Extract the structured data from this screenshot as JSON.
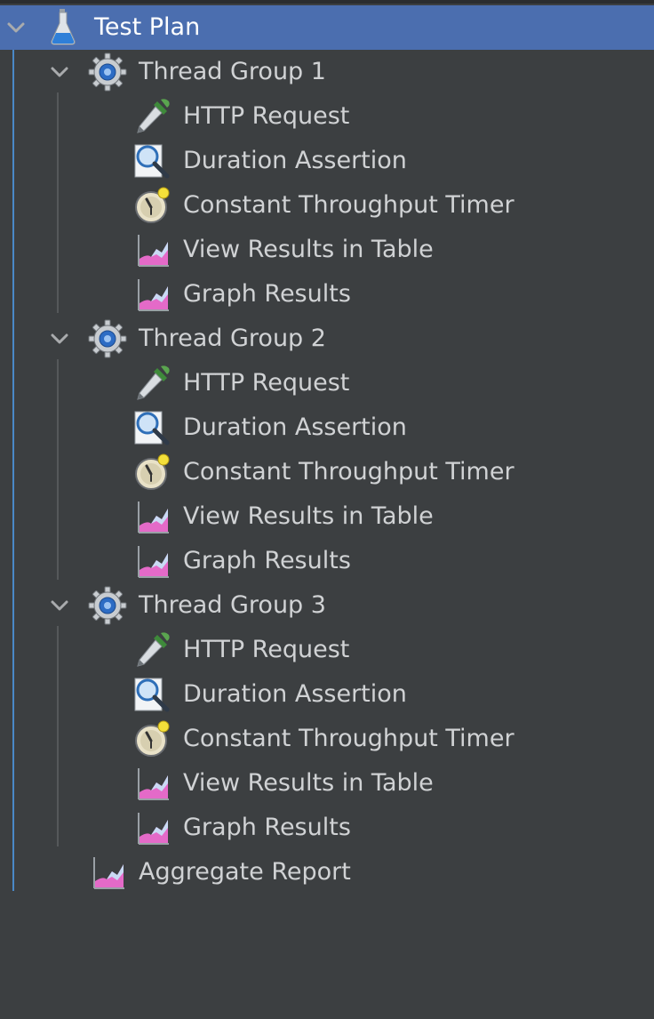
{
  "tree": {
    "root": {
      "label": "Test Plan",
      "icon": "test-plan-flask-icon",
      "expanded": true,
      "selected": true
    },
    "thread_groups": [
      {
        "label": "Thread Group 1",
        "icon": "gear-icon",
        "expanded": true,
        "children": [
          {
            "label": "HTTP Request",
            "icon": "pipette-icon"
          },
          {
            "label": "Duration Assertion",
            "icon": "magnifier-assertion-icon"
          },
          {
            "label": "Constant Throughput Timer",
            "icon": "stopwatch-icon"
          },
          {
            "label": "View Results in Table",
            "icon": "graph-listener-icon"
          },
          {
            "label": "Graph Results",
            "icon": "graph-listener-icon"
          }
        ]
      },
      {
        "label": "Thread Group 2",
        "icon": "gear-icon",
        "expanded": true,
        "children": [
          {
            "label": "HTTP Request",
            "icon": "pipette-icon"
          },
          {
            "label": "Duration Assertion",
            "icon": "magnifier-assertion-icon"
          },
          {
            "label": "Constant Throughput Timer",
            "icon": "stopwatch-icon"
          },
          {
            "label": "View Results in Table",
            "icon": "graph-listener-icon"
          },
          {
            "label": "Graph Results",
            "icon": "graph-listener-icon"
          }
        ]
      },
      {
        "label": "Thread Group 3",
        "icon": "gear-icon",
        "expanded": true,
        "children": [
          {
            "label": "HTTP Request",
            "icon": "pipette-icon"
          },
          {
            "label": "Duration Assertion",
            "icon": "magnifier-assertion-icon"
          },
          {
            "label": "Constant Throughput Timer",
            "icon": "stopwatch-icon"
          },
          {
            "label": "View Results in Table",
            "icon": "graph-listener-icon"
          },
          {
            "label": "Graph Results",
            "icon": "graph-listener-icon"
          }
        ]
      }
    ],
    "aggregate": {
      "label": "Aggregate Report",
      "icon": "graph-listener-icon"
    }
  },
  "colors": {
    "background": "#3c3f41",
    "selection": "#4b6eaf",
    "text": "#d0d2d4",
    "tree_line_root": "#4a88c7",
    "tree_line_child": "#55585a"
  }
}
